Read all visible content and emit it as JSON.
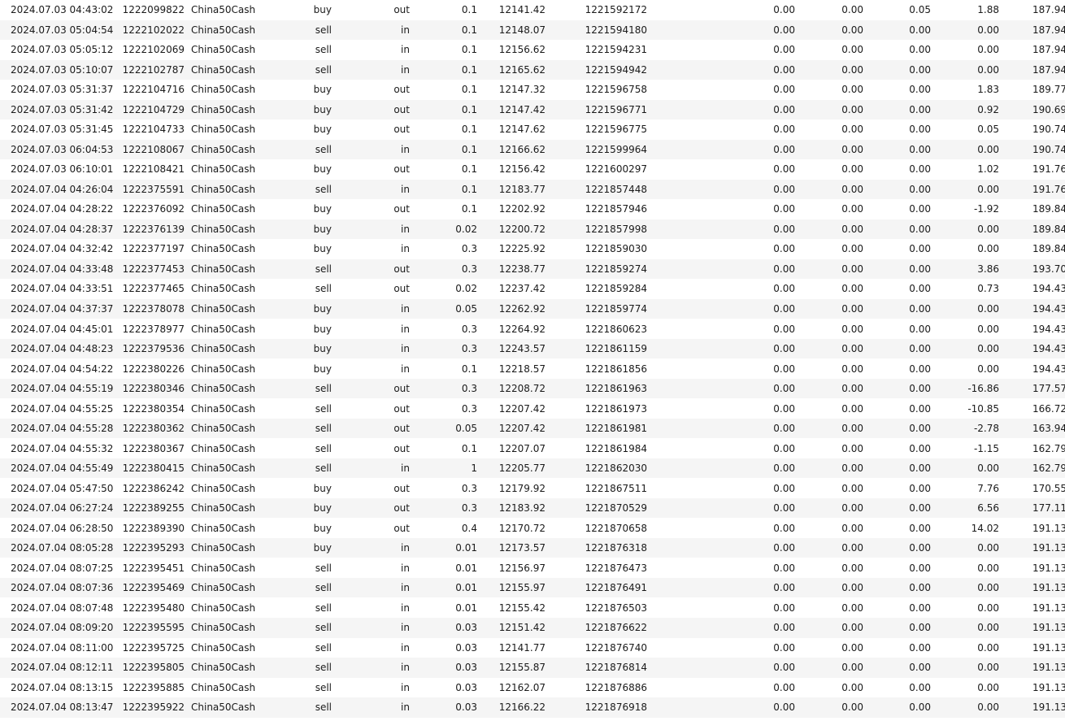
{
  "deals": {
    "rows": [
      [
        "2024.07.03 04:43:02",
        "1222099822",
        "China50Cash",
        "buy",
        "out",
        "0.1",
        "12141.42",
        "1221592172",
        "0.00",
        "0.00",
        "0.05",
        "1.88",
        "187.94"
      ],
      [
        "2024.07.03 05:04:54",
        "1222102022",
        "China50Cash",
        "sell",
        "in",
        "0.1",
        "12148.07",
        "1221594180",
        "0.00",
        "0.00",
        "0.00",
        "0.00",
        "187.94"
      ],
      [
        "2024.07.03 05:05:12",
        "1222102069",
        "China50Cash",
        "sell",
        "in",
        "0.1",
        "12156.62",
        "1221594231",
        "0.00",
        "0.00",
        "0.00",
        "0.00",
        "187.94"
      ],
      [
        "2024.07.03 05:10:07",
        "1222102787",
        "China50Cash",
        "sell",
        "in",
        "0.1",
        "12165.62",
        "1221594942",
        "0.00",
        "0.00",
        "0.00",
        "0.00",
        "187.94"
      ],
      [
        "2024.07.03 05:31:37",
        "1222104716",
        "China50Cash",
        "buy",
        "out",
        "0.1",
        "12147.32",
        "1221596758",
        "0.00",
        "0.00",
        "0.00",
        "1.83",
        "189.77"
      ],
      [
        "2024.07.03 05:31:42",
        "1222104729",
        "China50Cash",
        "buy",
        "out",
        "0.1",
        "12147.42",
        "1221596771",
        "0.00",
        "0.00",
        "0.00",
        "0.92",
        "190.69"
      ],
      [
        "2024.07.03 05:31:45",
        "1222104733",
        "China50Cash",
        "buy",
        "out",
        "0.1",
        "12147.62",
        "1221596775",
        "0.00",
        "0.00",
        "0.00",
        "0.05",
        "190.74"
      ],
      [
        "2024.07.03 06:04:53",
        "1222108067",
        "China50Cash",
        "sell",
        "in",
        "0.1",
        "12166.62",
        "1221599964",
        "0.00",
        "0.00",
        "0.00",
        "0.00",
        "190.74"
      ],
      [
        "2024.07.03 06:10:01",
        "1222108421",
        "China50Cash",
        "buy",
        "out",
        "0.1",
        "12156.42",
        "1221600297",
        "0.00",
        "0.00",
        "0.00",
        "1.02",
        "191.76"
      ],
      [
        "2024.07.04 04:26:04",
        "1222375591",
        "China50Cash",
        "sell",
        "in",
        "0.1",
        "12183.77",
        "1221857448",
        "0.00",
        "0.00",
        "0.00",
        "0.00",
        "191.76"
      ],
      [
        "2024.07.04 04:28:22",
        "1222376092",
        "China50Cash",
        "buy",
        "out",
        "0.1",
        "12202.92",
        "1221857946",
        "0.00",
        "0.00",
        "0.00",
        "-1.92",
        "189.84"
      ],
      [
        "2024.07.04 04:28:37",
        "1222376139",
        "China50Cash",
        "buy",
        "in",
        "0.02",
        "12200.72",
        "1221857998",
        "0.00",
        "0.00",
        "0.00",
        "0.00",
        "189.84"
      ],
      [
        "2024.07.04 04:32:42",
        "1222377197",
        "China50Cash",
        "buy",
        "in",
        "0.3",
        "12225.92",
        "1221859030",
        "0.00",
        "0.00",
        "0.00",
        "0.00",
        "189.84"
      ],
      [
        "2024.07.04 04:33:48",
        "1222377453",
        "China50Cash",
        "sell",
        "out",
        "0.3",
        "12238.77",
        "1221859274",
        "0.00",
        "0.00",
        "0.00",
        "3.86",
        "193.70"
      ],
      [
        "2024.07.04 04:33:51",
        "1222377465",
        "China50Cash",
        "sell",
        "out",
        "0.02",
        "12237.42",
        "1221859284",
        "0.00",
        "0.00",
        "0.00",
        "0.73",
        "194.43"
      ],
      [
        "2024.07.04 04:37:37",
        "1222378078",
        "China50Cash",
        "buy",
        "in",
        "0.05",
        "12262.92",
        "1221859774",
        "0.00",
        "0.00",
        "0.00",
        "0.00",
        "194.43"
      ],
      [
        "2024.07.04 04:45:01",
        "1222378977",
        "China50Cash",
        "buy",
        "in",
        "0.3",
        "12264.92",
        "1221860623",
        "0.00",
        "0.00",
        "0.00",
        "0.00",
        "194.43"
      ],
      [
        "2024.07.04 04:48:23",
        "1222379536",
        "China50Cash",
        "buy",
        "in",
        "0.3",
        "12243.57",
        "1221861159",
        "0.00",
        "0.00",
        "0.00",
        "0.00",
        "194.43"
      ],
      [
        "2024.07.04 04:54:22",
        "1222380226",
        "China50Cash",
        "buy",
        "in",
        "0.1",
        "12218.57",
        "1221861856",
        "0.00",
        "0.00",
        "0.00",
        "0.00",
        "194.43"
      ],
      [
        "2024.07.04 04:55:19",
        "1222380346",
        "China50Cash",
        "sell",
        "out",
        "0.3",
        "12208.72",
        "1221861963",
        "0.00",
        "0.00",
        "0.00",
        "-16.86",
        "177.57"
      ],
      [
        "2024.07.04 04:55:25",
        "1222380354",
        "China50Cash",
        "sell",
        "out",
        "0.3",
        "12207.42",
        "1221861973",
        "0.00",
        "0.00",
        "0.00",
        "-10.85",
        "166.72"
      ],
      [
        "2024.07.04 04:55:28",
        "1222380362",
        "China50Cash",
        "sell",
        "out",
        "0.05",
        "12207.42",
        "1221861981",
        "0.00",
        "0.00",
        "0.00",
        "-2.78",
        "163.94"
      ],
      [
        "2024.07.04 04:55:32",
        "1222380367",
        "China50Cash",
        "sell",
        "out",
        "0.1",
        "12207.07",
        "1221861984",
        "0.00",
        "0.00",
        "0.00",
        "-1.15",
        "162.79"
      ],
      [
        "2024.07.04 04:55:49",
        "1222380415",
        "China50Cash",
        "sell",
        "in",
        "1",
        "12205.77",
        "1221862030",
        "0.00",
        "0.00",
        "0.00",
        "0.00",
        "162.79"
      ],
      [
        "2024.07.04 05:47:50",
        "1222386242",
        "China50Cash",
        "buy",
        "out",
        "0.3",
        "12179.92",
        "1221867511",
        "0.00",
        "0.00",
        "0.00",
        "7.76",
        "170.55"
      ],
      [
        "2024.07.04 06:27:24",
        "1222389255",
        "China50Cash",
        "buy",
        "out",
        "0.3",
        "12183.92",
        "1221870529",
        "0.00",
        "0.00",
        "0.00",
        "6.56",
        "177.11"
      ],
      [
        "2024.07.04 06:28:50",
        "1222389390",
        "China50Cash",
        "buy",
        "out",
        "0.4",
        "12170.72",
        "1221870658",
        "0.00",
        "0.00",
        "0.00",
        "14.02",
        "191.13"
      ],
      [
        "2024.07.04 08:05:28",
        "1222395293",
        "China50Cash",
        "buy",
        "in",
        "0.01",
        "12173.57",
        "1221876318",
        "0.00",
        "0.00",
        "0.00",
        "0.00",
        "191.13"
      ],
      [
        "2024.07.04 08:07:25",
        "1222395451",
        "China50Cash",
        "sell",
        "in",
        "0.01",
        "12156.97",
        "1221876473",
        "0.00",
        "0.00",
        "0.00",
        "0.00",
        "191.13"
      ],
      [
        "2024.07.04 08:07:36",
        "1222395469",
        "China50Cash",
        "sell",
        "in",
        "0.01",
        "12155.97",
        "1221876491",
        "0.00",
        "0.00",
        "0.00",
        "0.00",
        "191.13"
      ],
      [
        "2024.07.04 08:07:48",
        "1222395480",
        "China50Cash",
        "sell",
        "in",
        "0.01",
        "12155.42",
        "1221876503",
        "0.00",
        "0.00",
        "0.00",
        "0.00",
        "191.13"
      ],
      [
        "2024.07.04 08:09:20",
        "1222395595",
        "China50Cash",
        "sell",
        "in",
        "0.03",
        "12151.42",
        "1221876622",
        "0.00",
        "0.00",
        "0.00",
        "0.00",
        "191.13"
      ],
      [
        "2024.07.04 08:11:00",
        "1222395725",
        "China50Cash",
        "sell",
        "in",
        "0.03",
        "12141.77",
        "1221876740",
        "0.00",
        "0.00",
        "0.00",
        "0.00",
        "191.13"
      ],
      [
        "2024.07.04 08:12:11",
        "1222395805",
        "China50Cash",
        "sell",
        "in",
        "0.03",
        "12155.87",
        "1221876814",
        "0.00",
        "0.00",
        "0.00",
        "0.00",
        "191.13"
      ],
      [
        "2024.07.04 08:13:15",
        "1222395885",
        "China50Cash",
        "sell",
        "in",
        "0.03",
        "12162.07",
        "1221876886",
        "0.00",
        "0.00",
        "0.00",
        "0.00",
        "191.13"
      ],
      [
        "2024.07.04 08:13:47",
        "1222395922",
        "China50Cash",
        "sell",
        "in",
        "0.03",
        "12166.22",
        "1221876918",
        "0.00",
        "0.00",
        "0.00",
        "0.00",
        "191.13"
      ]
    ]
  }
}
